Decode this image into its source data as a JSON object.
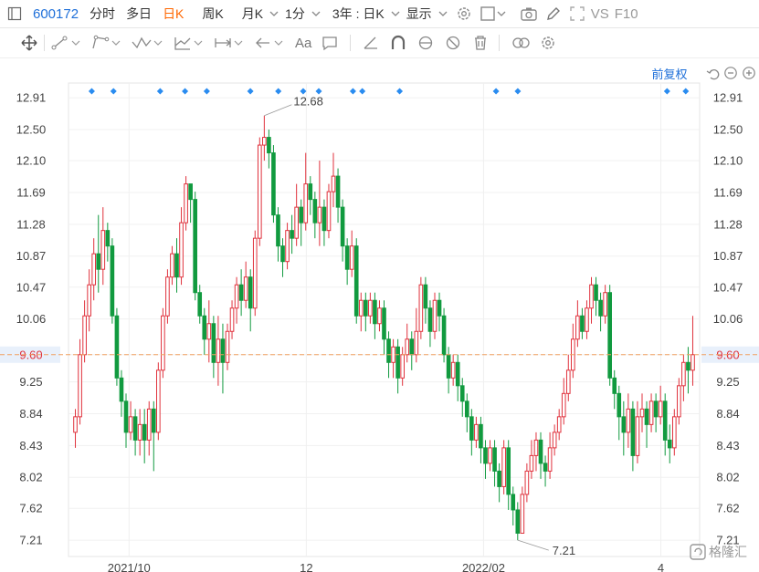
{
  "toolbar": {
    "stock_code": "600172",
    "intraday": "分时",
    "multi_day": "多日",
    "daily_k": "日K",
    "weekly_k": "周K",
    "monthly_k": "月K",
    "minute": "1分",
    "range": "3年 : 日K",
    "display": "显示",
    "compare": "VS",
    "f10": "F10"
  },
  "drawing_tools": {
    "text_tool": "Aa",
    "adjustment": "前复权"
  },
  "colors": {
    "accent": "#1e6fd9",
    "up": "#e0313c",
    "down": "#119a3f",
    "selected_tab": "#ff6600",
    "marker": "#2a8cf0",
    "price_line": "#f0a060",
    "current_price_bg": "#e8f0fb"
  },
  "chart_data": {
    "type": "candlestick",
    "y_ticks": [
      "12.91",
      "12.50",
      "12.10",
      "11.69",
      "11.28",
      "10.87",
      "10.47",
      "10.06",
      "9.60",
      "9.25",
      "8.84",
      "8.43",
      "8.02",
      "7.62",
      "7.21"
    ],
    "x_ticks": [
      "2021/10",
      "12",
      "2022/02",
      "4"
    ],
    "ylim": [
      7.0,
      13.1
    ],
    "grid": true,
    "current_price": 9.6,
    "high_label": "12.68",
    "low_label": "7.21",
    "candles": [
      [
        8.6,
        8.8,
        8.4,
        8.9
      ],
      [
        8.8,
        9.6,
        8.7,
        9.8
      ],
      [
        9.6,
        10.1,
        9.5,
        10.3
      ],
      [
        10.1,
        10.5,
        9.9,
        10.7
      ],
      [
        10.5,
        10.9,
        10.3,
        11.1
      ],
      [
        10.9,
        10.7,
        10.4,
        11.4
      ],
      [
        10.7,
        11.2,
        10.5,
        11.5
      ],
      [
        11.2,
        11.0,
        10.8,
        11.3
      ],
      [
        11.0,
        10.1,
        10.0,
        11.1
      ],
      [
        10.1,
        9.3,
        9.2,
        10.2
      ],
      [
        9.3,
        9.0,
        8.8,
        9.4
      ],
      [
        9.0,
        8.6,
        8.4,
        9.1
      ],
      [
        8.6,
        8.8,
        8.5,
        9.0
      ],
      [
        8.8,
        8.5,
        8.3,
        8.9
      ],
      [
        8.5,
        8.7,
        8.3,
        8.9
      ],
      [
        8.7,
        8.5,
        8.2,
        8.9
      ],
      [
        8.5,
        8.9,
        8.3,
        9.0
      ],
      [
        8.9,
        8.6,
        8.1,
        9.0
      ],
      [
        8.6,
        9.4,
        8.5,
        9.5
      ],
      [
        9.4,
        10.1,
        9.3,
        10.2
      ],
      [
        10.1,
        10.6,
        10.0,
        10.7
      ],
      [
        10.6,
        10.9,
        10.5,
        11.0
      ],
      [
        10.9,
        10.6,
        10.4,
        11.1
      ],
      [
        10.6,
        11.3,
        10.5,
        11.5
      ],
      [
        11.3,
        11.8,
        11.2,
        11.9
      ],
      [
        11.8,
        11.6,
        11.3,
        11.8
      ],
      [
        11.6,
        10.4,
        10.3,
        11.7
      ],
      [
        10.4,
        10.1,
        10.0,
        10.5
      ],
      [
        10.1,
        9.8,
        9.6,
        10.2
      ],
      [
        9.8,
        10.0,
        9.5,
        10.3
      ],
      [
        10.0,
        9.5,
        9.3,
        10.1
      ],
      [
        9.5,
        9.8,
        9.2,
        10.1
      ],
      [
        9.8,
        9.5,
        9.1,
        10.0
      ],
      [
        9.5,
        9.9,
        9.4,
        10.0
      ],
      [
        9.9,
        10.2,
        9.8,
        10.3
      ],
      [
        10.2,
        10.5,
        10.0,
        10.6
      ],
      [
        10.5,
        10.3,
        10.1,
        10.7
      ],
      [
        10.3,
        10.6,
        10.2,
        10.8
      ],
      [
        10.6,
        10.2,
        9.9,
        10.7
      ],
      [
        10.2,
        11.1,
        10.1,
        11.2
      ],
      [
        11.1,
        12.3,
        11.0,
        12.4
      ],
      [
        12.3,
        12.4,
        12.1,
        12.68
      ],
      [
        12.4,
        12.2,
        12.0,
        12.5
      ],
      [
        12.2,
        11.4,
        11.3,
        12.3
      ],
      [
        11.4,
        11.0,
        10.8,
        11.5
      ],
      [
        11.0,
        10.8,
        10.6,
        11.1
      ],
      [
        10.8,
        11.2,
        10.7,
        11.3
      ],
      [
        11.2,
        11.1,
        10.9,
        11.4
      ],
      [
        11.1,
        11.5,
        11.0,
        11.8
      ],
      [
        11.5,
        11.3,
        11.0,
        11.6
      ],
      [
        11.3,
        11.8,
        11.2,
        12.2
      ],
      [
        11.8,
        11.6,
        11.4,
        11.9
      ],
      [
        11.6,
        11.3,
        11.1,
        11.7
      ],
      [
        11.3,
        11.5,
        11.0,
        12.1
      ],
      [
        11.5,
        11.2,
        11.0,
        11.6
      ],
      [
        11.2,
        11.7,
        11.1,
        11.8
      ],
      [
        11.7,
        11.9,
        11.5,
        12.2
      ],
      [
        11.9,
        11.5,
        11.3,
        12.0
      ],
      [
        11.5,
        11.0,
        10.8,
        11.6
      ],
      [
        11.0,
        10.7,
        10.5,
        11.1
      ],
      [
        10.7,
        11.0,
        10.6,
        11.2
      ],
      [
        11.0,
        10.1,
        10.0,
        11.1
      ],
      [
        10.1,
        10.3,
        9.9,
        10.4
      ],
      [
        10.3,
        10.1,
        9.9,
        10.4
      ],
      [
        10.1,
        10.3,
        10.0,
        10.4
      ],
      [
        10.3,
        10.0,
        9.8,
        10.4
      ],
      [
        10.0,
        10.2,
        9.9,
        10.3
      ],
      [
        10.2,
        9.8,
        9.6,
        10.3
      ],
      [
        9.8,
        9.5,
        9.3,
        9.9
      ],
      [
        9.5,
        9.7,
        9.3,
        9.8
      ],
      [
        9.7,
        9.3,
        9.1,
        9.8
      ],
      [
        9.3,
        9.6,
        9.2,
        9.7
      ],
      [
        9.6,
        9.8,
        9.5,
        10.0
      ],
      [
        9.8,
        9.6,
        9.4,
        9.9
      ],
      [
        9.6,
        9.9,
        9.5,
        10.2
      ],
      [
        9.9,
        10.5,
        9.8,
        10.6
      ],
      [
        10.5,
        10.2,
        10.0,
        10.6
      ],
      [
        10.2,
        9.9,
        9.7,
        10.3
      ],
      [
        9.9,
        10.3,
        9.8,
        10.4
      ],
      [
        10.3,
        10.1,
        9.9,
        10.4
      ],
      [
        10.1,
        9.6,
        9.5,
        10.2
      ],
      [
        9.6,
        9.3,
        9.1,
        9.7
      ],
      [
        9.3,
        9.5,
        9.2,
        9.6
      ],
      [
        9.5,
        9.2,
        9.0,
        9.6
      ],
      [
        9.2,
        9.0,
        8.8,
        9.3
      ],
      [
        9.0,
        8.8,
        8.6,
        9.1
      ],
      [
        8.8,
        8.5,
        8.3,
        8.9
      ],
      [
        8.5,
        8.7,
        8.4,
        8.8
      ],
      [
        8.7,
        8.4,
        8.2,
        8.8
      ],
      [
        8.4,
        8.2,
        8.0,
        8.5
      ],
      [
        8.2,
        8.4,
        8.1,
        8.5
      ],
      [
        8.4,
        8.1,
        7.9,
        8.5
      ],
      [
        8.1,
        7.9,
        7.7,
        8.2
      ],
      [
        7.9,
        8.4,
        7.8,
        8.5
      ],
      [
        8.4,
        7.8,
        7.6,
        8.5
      ],
      [
        7.8,
        7.6,
        7.4,
        7.9
      ],
      [
        7.6,
        7.3,
        7.21,
        7.7
      ],
      [
        7.3,
        7.8,
        7.3,
        7.9
      ],
      [
        7.8,
        8.1,
        7.7,
        8.2
      ],
      [
        8.1,
        8.3,
        8.0,
        8.5
      ],
      [
        8.3,
        8.5,
        8.1,
        8.6
      ],
      [
        8.5,
        8.2,
        8.0,
        8.6
      ],
      [
        8.2,
        8.1,
        7.9,
        8.3
      ],
      [
        8.1,
        8.4,
        8.0,
        8.6
      ],
      [
        8.4,
        8.6,
        8.3,
        8.7
      ],
      [
        8.6,
        8.8,
        8.5,
        8.9
      ],
      [
        8.8,
        9.1,
        8.7,
        9.3
      ],
      [
        9.1,
        9.4,
        9.0,
        9.6
      ],
      [
        9.4,
        9.8,
        9.3,
        10.0
      ],
      [
        9.8,
        10.1,
        9.7,
        10.3
      ],
      [
        10.1,
        9.9,
        9.8,
        10.2
      ],
      [
        9.9,
        10.2,
        9.8,
        10.3
      ],
      [
        10.2,
        10.5,
        10.0,
        10.6
      ],
      [
        10.5,
        10.3,
        10.1,
        10.6
      ],
      [
        10.3,
        10.1,
        9.9,
        10.4
      ],
      [
        10.1,
        10.4,
        10.0,
        10.5
      ],
      [
        10.4,
        9.3,
        9.2,
        10.5
      ],
      [
        9.3,
        9.1,
        8.9,
        9.4
      ],
      [
        9.1,
        8.8,
        8.5,
        9.2
      ],
      [
        8.8,
        8.6,
        8.3,
        9.0
      ],
      [
        8.6,
        8.9,
        8.4,
        9.1
      ],
      [
        8.9,
        8.3,
        8.1,
        9.0
      ],
      [
        8.3,
        8.8,
        8.2,
        9.0
      ],
      [
        8.8,
        8.9,
        8.6,
        9.1
      ],
      [
        8.9,
        8.7,
        8.4,
        9.0
      ],
      [
        8.7,
        9.0,
        8.6,
        9.1
      ],
      [
        9.0,
        8.8,
        8.6,
        9.1
      ],
      [
        8.8,
        9.0,
        8.7,
        9.2
      ],
      [
        9.0,
        8.5,
        8.3,
        9.1
      ],
      [
        8.5,
        8.4,
        8.2,
        8.7
      ],
      [
        8.4,
        8.8,
        8.3,
        8.9
      ],
      [
        8.8,
        9.2,
        8.7,
        9.3
      ],
      [
        9.2,
        9.5,
        9.0,
        9.6
      ],
      [
        9.5,
        9.4,
        9.1,
        9.7
      ],
      [
        9.4,
        9.6,
        9.2,
        10.1
      ]
    ],
    "markers": [
      0.03,
      0.065,
      0.14,
      0.18,
      0.215,
      0.285,
      0.33,
      0.37,
      0.395,
      0.45,
      0.465,
      0.525,
      0.68,
      0.715,
      0.955,
      0.985
    ]
  }
}
